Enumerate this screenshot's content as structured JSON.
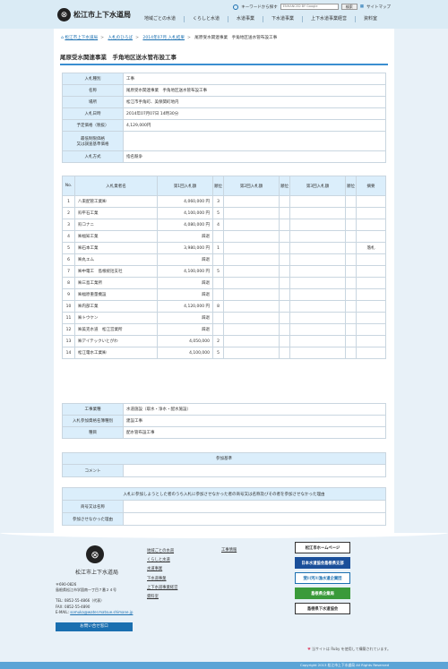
{
  "header": {
    "logo_text": "松江市上下水道局",
    "keyword_search_label": "キーワードから探す",
    "search_placeholder": "ENHANCED BY Google",
    "search_button": "検索",
    "sitemap_label": "サイトマップ",
    "nav": [
      "地域ごとの水道",
      "くらしと水道",
      "水道事業",
      "下水道事業",
      "上下水道事業経営",
      "資料室"
    ]
  },
  "breadcrumb": {
    "items": [
      "松江市上下水道局",
      "入札のひろば",
      "2014年07月 入札結果"
    ],
    "current": "尾原受水関連事業　手角地区送水管布設工事"
  },
  "page_title": "尾原受水関連事業　手角地区送水管布設工事",
  "info": [
    {
      "label": "入札種別",
      "value": "工事"
    },
    {
      "label": "名称",
      "value": "尾原受水関連事業　手角地区送水管布設工事"
    },
    {
      "label": "場所",
      "value": "松江市手角町、美保関町地内"
    },
    {
      "label": "入札日時",
      "value": "2014年07月07日 14時30分"
    },
    {
      "label": "予定価格（税抜）",
      "value": "4,129,000円"
    },
    {
      "label": "最低制限価格\n又は調査基準価格",
      "value": ""
    },
    {
      "label": "入札方式",
      "value": "指名競争"
    }
  ],
  "bids": {
    "headers": [
      "No.",
      "入札業者名",
      "第1回入札額",
      "順位",
      "第2回入札額",
      "順位",
      "第3回入札額",
      "順位",
      "摘要"
    ],
    "rows": [
      {
        "no": "1",
        "name": "八束配管工業㈱",
        "amt1": "4,060,000 円",
        "rank1": "3",
        "note": ""
      },
      {
        "no": "2",
        "name": "㈲平石工業",
        "amt1": "4,100,000 円",
        "rank1": "5",
        "note": ""
      },
      {
        "no": "3",
        "name": "㈲コナニ",
        "amt1": "4,080,000 円",
        "rank1": "4",
        "note": ""
      },
      {
        "no": "4",
        "name": "㈱福知工業",
        "amt1": "辞退",
        "rank1": "",
        "note": ""
      },
      {
        "no": "5",
        "name": "㈱石本工業",
        "amt1": "3,980,000 円",
        "rank1": "1",
        "note": "落札"
      },
      {
        "no": "6",
        "name": "㈱丸エム",
        "amt1": "辞退",
        "rank1": "",
        "note": ""
      },
      {
        "no": "7",
        "name": "㈱中電工　島根統括支社",
        "amt1": "4,100,000 円",
        "rank1": "5",
        "note": ""
      },
      {
        "no": "8",
        "name": "㈱三島工業所",
        "amt1": "辞退",
        "rank1": "",
        "note": ""
      },
      {
        "no": "9",
        "name": "㈱福原重量機設",
        "amt1": "辞退",
        "rank1": "",
        "note": ""
      },
      {
        "no": "10",
        "name": "㈱内部工業",
        "amt1": "4,120,000 円",
        "rank1": "8",
        "note": ""
      },
      {
        "no": "11",
        "name": "㈱トウケン",
        "amt1": "辞退",
        "rank1": "",
        "note": ""
      },
      {
        "no": "12",
        "name": "㈱美克水道　松江営業所",
        "amt1": "辞退",
        "rank1": "",
        "note": ""
      },
      {
        "no": "13",
        "name": "㈱アイテックいとがわ",
        "amt1": "4,050,000",
        "rank1": "2",
        "note": ""
      },
      {
        "no": "14",
        "name": "松江電水工業㈱",
        "amt1": "4,100,000",
        "rank1": "5",
        "note": ""
      }
    ]
  },
  "work": [
    {
      "label": "工事業種",
      "value": "水道施設（取水・浄水・配水施設）"
    },
    {
      "label": "入札参加資格名簿種別",
      "value": "建設工事"
    },
    {
      "label": "種目",
      "value": "配水管布設工事"
    }
  ],
  "requirement": {
    "heading": "参加基準",
    "label": "コメント",
    "value": ""
  },
  "nonparticipation": {
    "heading": "入札に参加しようとした者のうち入札に参加させなかった者の商号又は名称及びその者を参加させなかった理由",
    "rows": [
      {
        "label": "商号又は名称",
        "value": ""
      },
      {
        "label": "参加させなかった理由",
        "value": ""
      }
    ]
  },
  "footer": {
    "org_name": "松江市上下水道局",
    "address": [
      "〒690-0826",
      "島根県松江市学園南一丁目７番２４号",
      "",
      "TEL: 0852-55-4866（代表）",
      "FAX: 0852-55-4890"
    ],
    "email_label": "E-MAIL:",
    "email": "somuka@water.matsue.shimane.jp",
    "contact_button": "お問い合せ窓口",
    "links": [
      "地域ごとの水道",
      "くらしと水道",
      "水道事業",
      "下水道事業",
      "上下水道事業経営",
      "資料室"
    ],
    "links2": [
      "工事情報"
    ],
    "banners": [
      "松江市ホームページ",
      "日本水道協会島根県支部",
      "斐川河川漁水道企業団",
      "島根県企業局",
      "島根県下水道協会"
    ],
    "ruby_note": "当サイトは Ruby を使用して構築されています。",
    "copyright": "Copyright 2013 松江市上下水道局 All Rights Reserved"
  }
}
